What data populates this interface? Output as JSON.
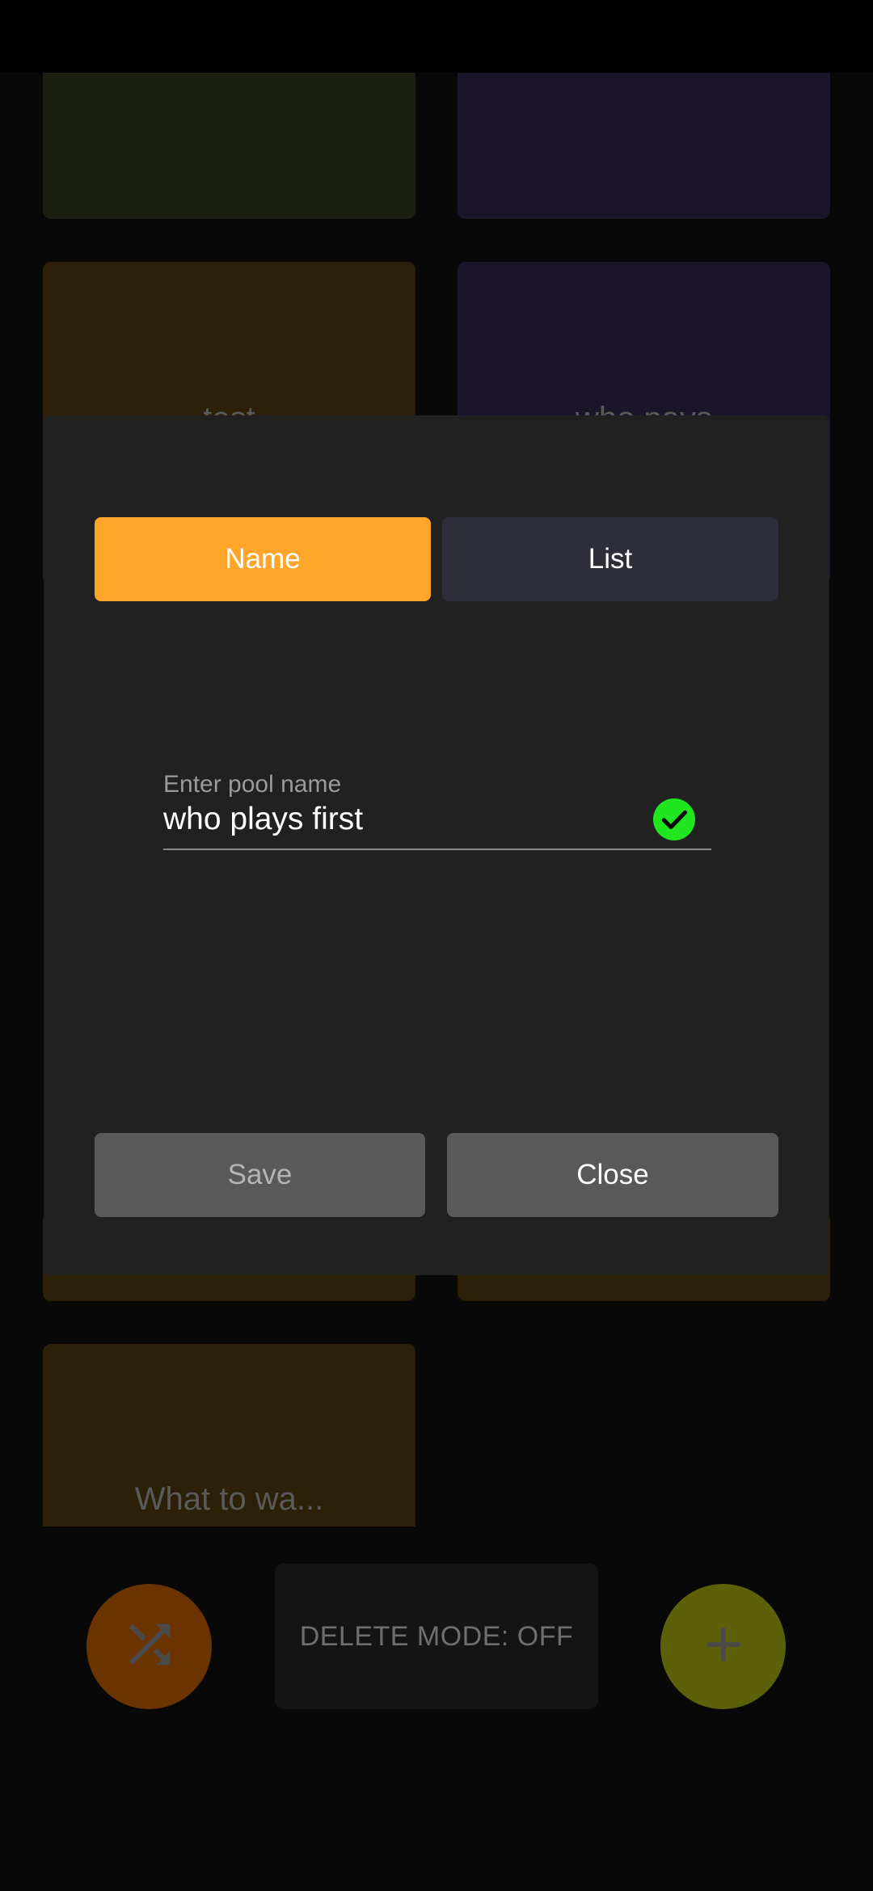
{
  "background_tiles": [
    {
      "label": "",
      "color": "#1a1f12"
    },
    {
      "label": "",
      "color": "#1a1528"
    },
    {
      "label": "test",
      "color": "#2c2008"
    },
    {
      "label": "who pays",
      "color": "#1a1528"
    },
    {
      "label": "What to wa...",
      "color": "#2d2009"
    }
  ],
  "bottom_bar": {
    "shuffle_icon": "shuffle-icon",
    "delete_mode_label": "DELETE MODE: OFF",
    "add_icon": "plus-icon"
  },
  "dialog": {
    "tabs": [
      {
        "label": "Name",
        "active": true
      },
      {
        "label": "List",
        "active": false
      }
    ],
    "field": {
      "label": "Enter pool name",
      "value": "who plays first",
      "valid_icon": "check-circle-icon"
    },
    "save_label": "Save",
    "close_label": "Close"
  },
  "colors": {
    "accent": "#ffa52a",
    "tab_inactive": "#2e2d3a",
    "valid": "#1fe61f",
    "button": "#595959"
  }
}
